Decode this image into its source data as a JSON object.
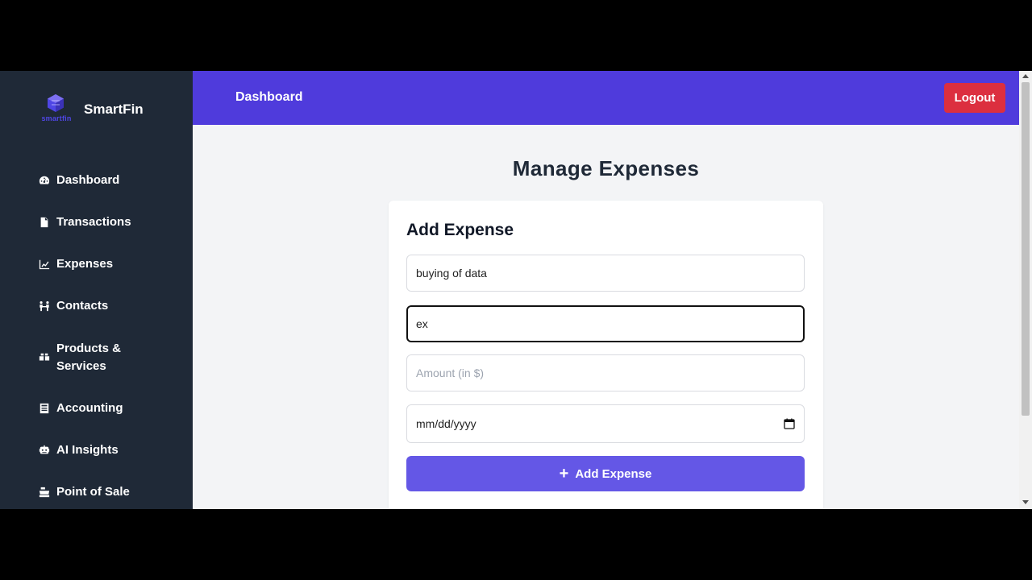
{
  "brand": {
    "name": "SmartFin",
    "logo_sub": "smartfin"
  },
  "sidebar": {
    "items": [
      {
        "label": "Dashboard",
        "icon": "gauge-icon"
      },
      {
        "label": "Transactions",
        "icon": "file-invoice-icon"
      },
      {
        "label": "Expenses",
        "icon": "chart-line-icon"
      },
      {
        "label": "Contacts",
        "icon": "people-icon"
      },
      {
        "label": "Products & Services",
        "icon": "boxes-icon"
      },
      {
        "label": "Accounting",
        "icon": "ledger-icon"
      },
      {
        "label": "AI Insights",
        "icon": "robot-icon"
      },
      {
        "label": "Point of Sale",
        "icon": "cash-register-icon"
      }
    ]
  },
  "topbar": {
    "title": "Dashboard",
    "logout_label": "Logout"
  },
  "main": {
    "page_title": "Manage Expenses",
    "form": {
      "title": "Add Expense",
      "description_value": "buying of data",
      "category_value": "ex",
      "amount_placeholder": "Amount (in $)",
      "date_placeholder": "mm/dd/yyyy",
      "submit_label": "Add Expense"
    }
  },
  "colors": {
    "sidebar_bg": "#1f2937",
    "topbar_bg": "#4f3bdc",
    "logout_bg": "#dc2f3f",
    "button_bg": "#6457e6",
    "content_bg": "#f3f4f6"
  }
}
